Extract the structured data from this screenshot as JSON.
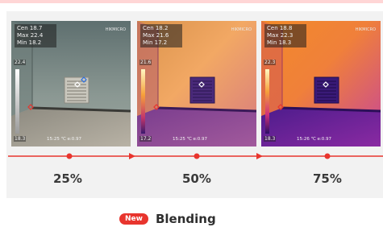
{
  "frames": [
    {
      "readout": {
        "cen": "Cen 18.7",
        "max": "Max 22.4",
        "min": "Min 18.2"
      },
      "brand": "HIKMICRO",
      "scale_top": "22.4",
      "scale_bottom": "18.3",
      "status": "15:25  ℃  e:0.97",
      "percent": "25%"
    },
    {
      "readout": {
        "cen": "Cen 18.2",
        "max": "Max 21.6",
        "min": "Min 17.2"
      },
      "brand": "HIKMICRO",
      "scale_top": "21.6",
      "scale_bottom": "17.2",
      "status": "15:25  ℃  e:0.97",
      "percent": "50%"
    },
    {
      "readout": {
        "cen": "Cen 18.8",
        "max": "Max 22.3",
        "min": "Min 18.3"
      },
      "brand": "HIKMICRO",
      "scale_top": "22.3",
      "scale_bottom": "18.3",
      "status": "15:26  ℃  e:0.97",
      "percent": "75%"
    }
  ],
  "feature": {
    "badge": "New",
    "label": "Blending"
  },
  "colors": {
    "accent": "#e8352e",
    "panel": "#f2f2f2"
  }
}
